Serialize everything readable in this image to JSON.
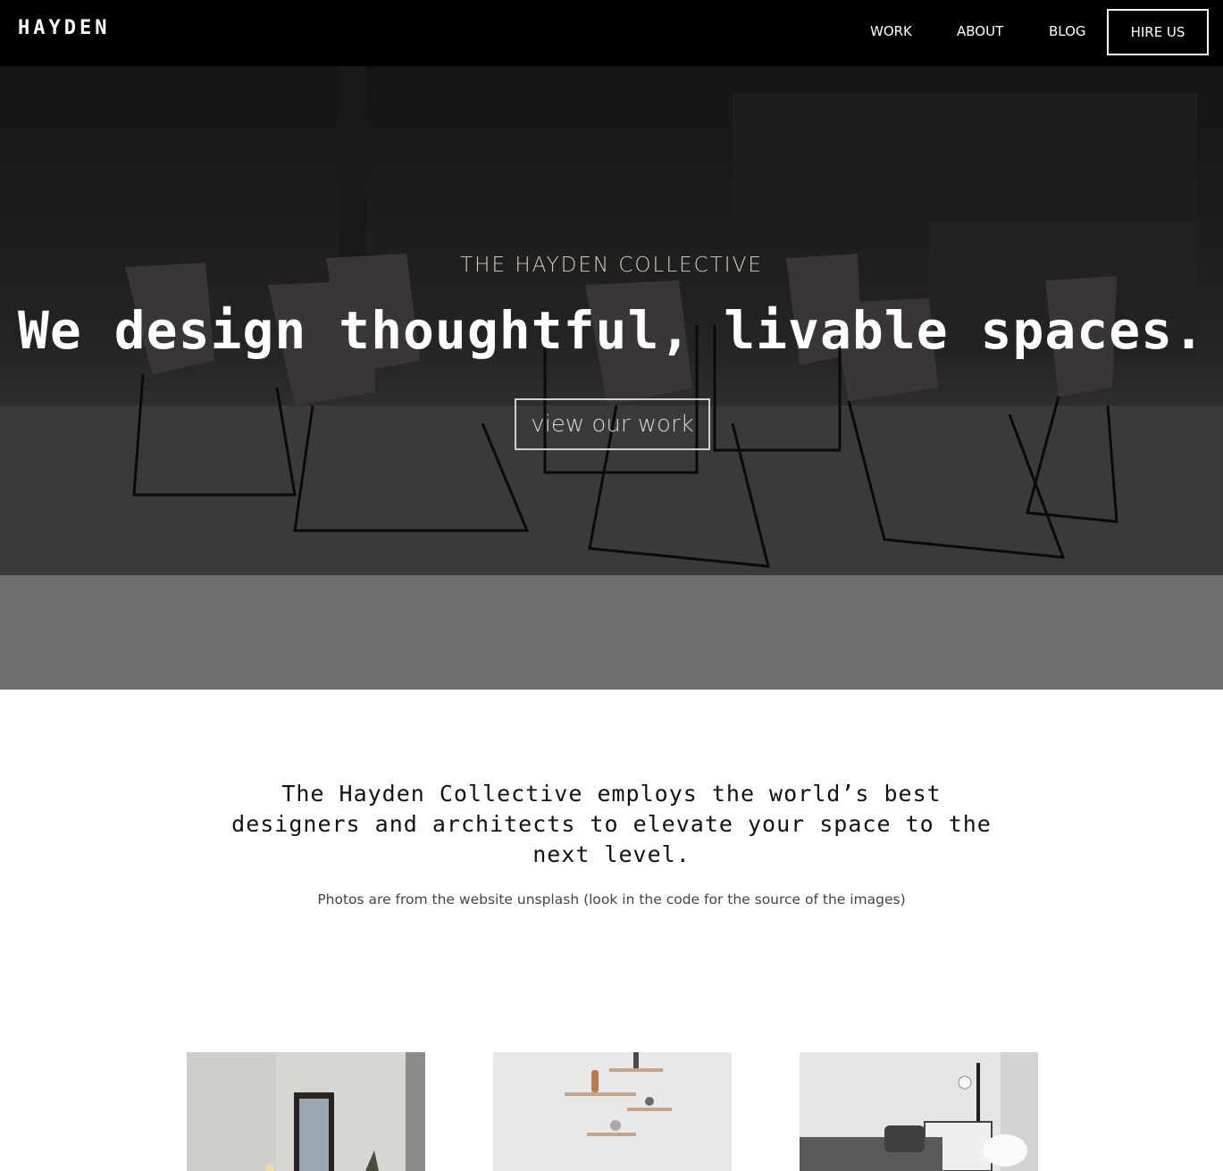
{
  "nav": {
    "brand": "HAYDEN",
    "links": [
      "WORK",
      "ABOUT",
      "BLOG"
    ],
    "cta": "HIRE US"
  },
  "hero": {
    "subtitle": "THE HAYDEN COLLECTIVE",
    "title": "We design thoughtful, livable spaces.",
    "button": "view our work"
  },
  "intro": {
    "text": "The Hayden Collective employs the world’s best designers and architects to elevate your space to the next level.",
    "note": "Photos are from the website unsplash (look in the code for the source of the images)"
  },
  "colors": {
    "navbar": "#000000",
    "hero_overlay": "#6f6f6f",
    "text_dark": "#111111"
  }
}
